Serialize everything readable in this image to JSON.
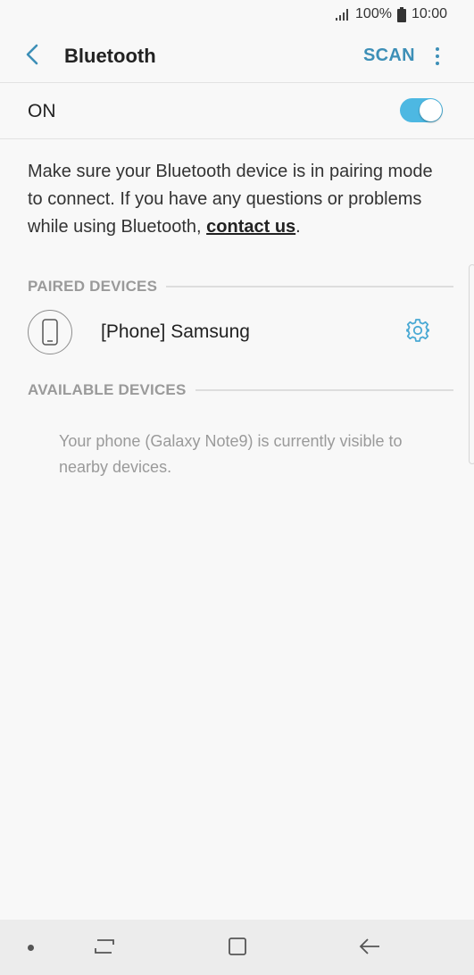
{
  "status_bar": {
    "battery": "100%",
    "time": "10:00",
    "icons": [
      "signal-icon",
      "battery-icon"
    ]
  },
  "app_bar": {
    "title": "Bluetooth",
    "scan_label": "SCAN",
    "icons": [
      "back-arrow-icon",
      "more-options-icon"
    ]
  },
  "bluetooth_toggle": {
    "label": "ON",
    "state": true
  },
  "info": {
    "text": "Make sure your Bluetooth device is in pairing mode to connect. If you have any questions or problems while using Bluetooth, ",
    "link": "contact us",
    "suffix": "."
  },
  "paired": {
    "header": "PAIRED DEVICES",
    "devices": [
      {
        "name": "[Phone] Samsung",
        "icon": "phone-icon",
        "settings_icon": "gear-icon"
      }
    ]
  },
  "available": {
    "header": "AVAILABLE DEVICES",
    "message": "Your phone (Galaxy Note9) is currently visible to nearby devices."
  },
  "nav_bar": {
    "icons": [
      "recent-apps-icon",
      "home-icon",
      "back-icon"
    ]
  },
  "colors": {
    "accent": "#3d8fb7",
    "toggle_on": "#4db8e2",
    "background": "#f8f8f8"
  }
}
